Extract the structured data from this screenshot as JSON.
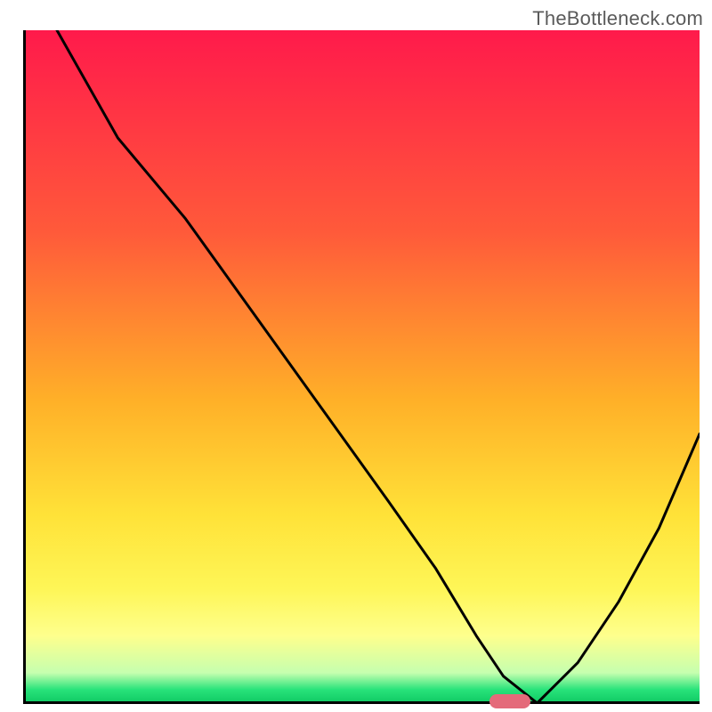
{
  "watermark": "TheBottleneck.com",
  "chart_data": {
    "type": "line",
    "title": "",
    "xlabel": "",
    "ylabel": "",
    "xlim": [
      0,
      100
    ],
    "ylim": [
      0,
      100
    ],
    "grid": false,
    "legend": false,
    "background": "rainbow-vertical",
    "series": [
      {
        "name": "bottleneck-curve",
        "color": "#000000",
        "x": [
          5,
          14,
          24,
          34,
          44,
          54,
          61,
          67,
          71,
          76,
          82,
          88,
          94,
          100
        ],
        "values": [
          100,
          84,
          72,
          58,
          44,
          30,
          20,
          10,
          4,
          0,
          6,
          15,
          26,
          40
        ]
      }
    ],
    "marker": {
      "x_pct": 72,
      "width_pct": 6
    },
    "colors": {
      "top": "#ff1a4b",
      "mid_high": "#ff5a3a",
      "mid": "#ffe238",
      "mid_low": "#feff8d",
      "bottom": "#0fc964",
      "curve": "#000000",
      "marker": "#e46a7a",
      "watermark_text": "#5a5a5a"
    }
  }
}
